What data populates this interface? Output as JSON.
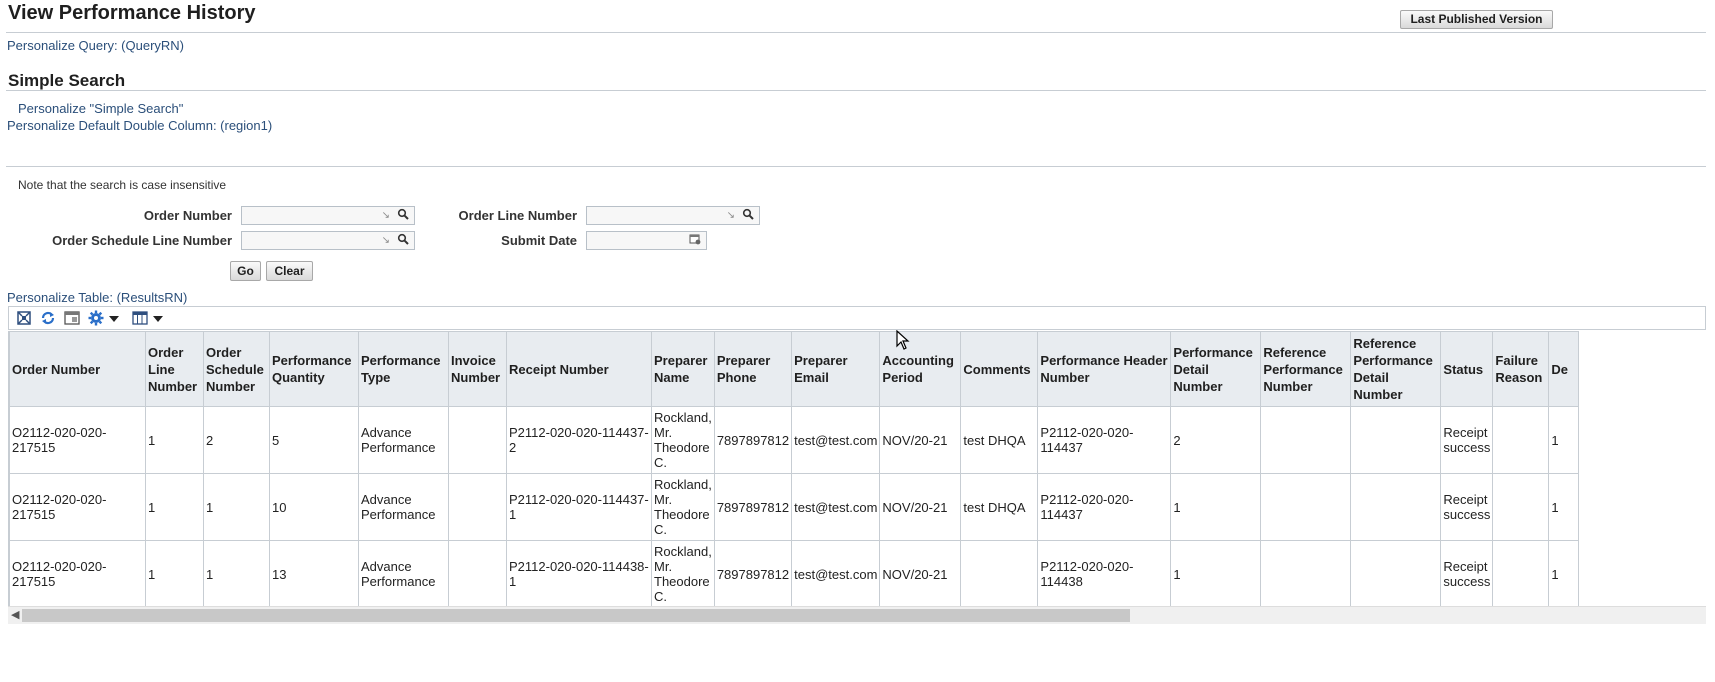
{
  "header": {
    "title": "View Performance History",
    "last_published_label": "Last Published Version"
  },
  "links": {
    "personalize_query": "Personalize Query: (QueryRN)",
    "personalize_simple_search": "Personalize \"Simple Search\"",
    "personalize_double_column": "Personalize Default Double Column: (region1)",
    "personalize_table": "Personalize Table: (ResultsRN)"
  },
  "search": {
    "section_title": "Simple Search",
    "note": "Note that the search is case insensitive",
    "fields": {
      "order_number": {
        "label": "Order Number",
        "value": ""
      },
      "order_line_number": {
        "label": "Order Line Number",
        "value": ""
      },
      "order_schedule_line_number": {
        "label": "Order Schedule Line Number",
        "value": ""
      },
      "submit_date": {
        "label": "Submit Date",
        "value": ""
      }
    },
    "go_label": "Go",
    "clear_label": "Clear"
  },
  "toolbar": {
    "icons": [
      "detach-icon",
      "refresh-icon",
      "freeze-icon",
      "settings-icon",
      "columns-icon"
    ]
  },
  "table": {
    "columns": [
      "Order Number",
      "Order Line Number",
      "Order Schedule Number",
      "Performance Quantity",
      "Performance Type",
      "Invoice Number",
      "Receipt Number",
      "Preparer Name",
      "Preparer Phone",
      "Preparer Email",
      "Accounting Period",
      "Comments",
      "Performance Header Number",
      "Performance Detail Number",
      "Reference Performance Number",
      "Reference Performance Detail Number",
      "Status",
      "Failure Reason",
      "De"
    ],
    "rows": [
      [
        "O2112-020-020-217515",
        "1",
        "2",
        "5",
        "Advance Performance",
        "",
        "P2112-020-020-114437-2",
        "Rockland, Mr. Theodore C.",
        "7897897812",
        "test@test.com",
        "NOV/20-21",
        "test DHQA",
        "P2112-020-020-114437",
        "2",
        "",
        "",
        "Receipt success",
        "",
        "1"
      ],
      [
        "O2112-020-020-217515",
        "1",
        "1",
        "10",
        "Advance Performance",
        "",
        "P2112-020-020-114437-1",
        "Rockland, Mr. Theodore C.",
        "7897897812",
        "test@test.com",
        "NOV/20-21",
        "test DHQA",
        "P2112-020-020-114437",
        "1",
        "",
        "",
        "Receipt success",
        "",
        "1"
      ],
      [
        "O2112-020-020-217515",
        "1",
        "1",
        "13",
        "Advance Performance",
        "",
        "P2112-020-020-114438-1",
        "Rockland, Mr. Theodore C.",
        "7897897812",
        "test@test.com",
        "NOV/20-21",
        "",
        "P2112-020-020-114438",
        "1",
        "",
        "",
        "Receipt success",
        "",
        "1"
      ]
    ]
  }
}
